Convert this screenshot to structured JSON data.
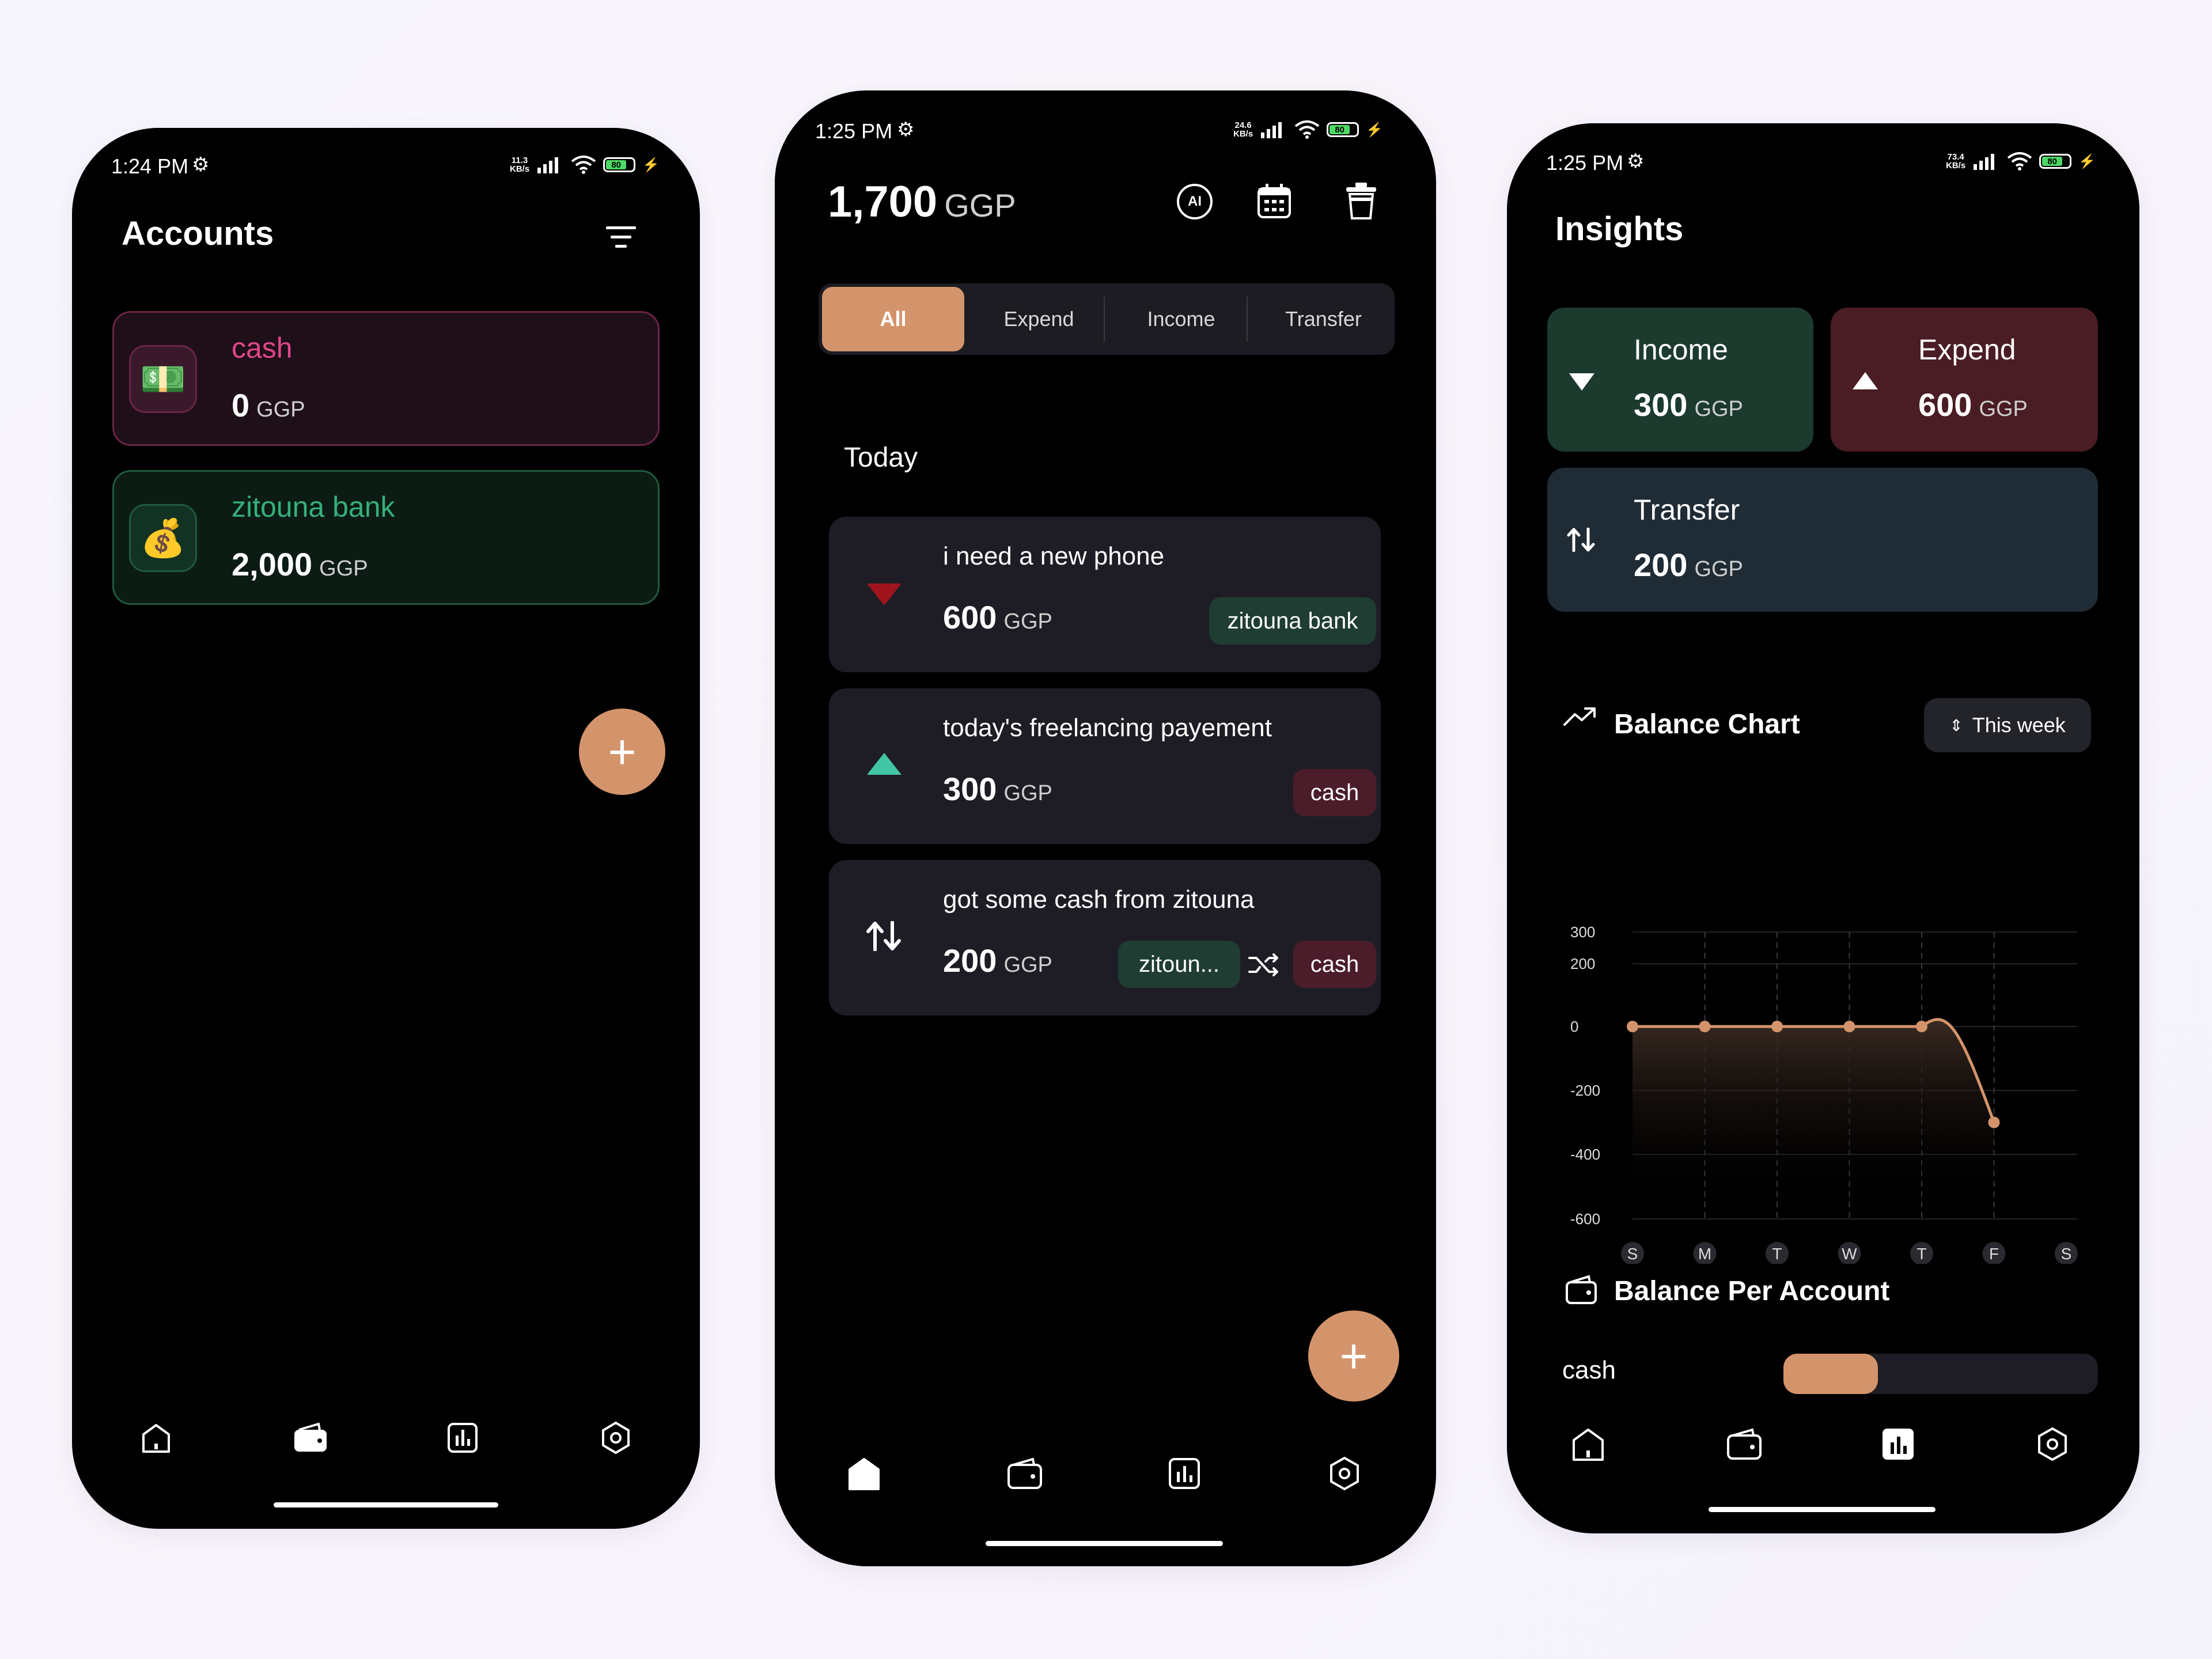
{
  "phone1": {
    "time": "1:24 PM",
    "kbs_value": "11.3",
    "kbs_unit": "KB/s",
    "battery": "80",
    "title": "Accounts",
    "accounts": [
      {
        "name": "cash",
        "amount": "0",
        "unit": "GGP",
        "icon": "banknote-icon",
        "color": "#e0478a"
      },
      {
        "name": "zitouna bank",
        "amount": "2,000",
        "unit": "GGP",
        "icon": "money-bag-icon",
        "color": "#35b07a"
      }
    ],
    "fab": "+"
  },
  "phone2": {
    "time": "1:25 PM",
    "kbs_value": "24.6",
    "kbs_unit": "KB/s",
    "battery": "80",
    "balance": "1,700",
    "balance_unit": "GGP",
    "ai_label": "AI",
    "tabs": [
      "All",
      "Expend",
      "Income",
      "Transfer"
    ],
    "section": "Today",
    "transactions": [
      {
        "desc": "i need a new phone",
        "amount": "600",
        "unit": "GGP",
        "type": "expend",
        "account": "zitouna bank"
      },
      {
        "desc": "today's freelancing payement",
        "amount": "300",
        "unit": "GGP",
        "type": "income",
        "account": "cash"
      },
      {
        "desc": "got some cash from zitouna",
        "amount": "200",
        "unit": "GGP",
        "type": "transfer",
        "from": "zitoun...",
        "to": "cash"
      }
    ],
    "fab": "+"
  },
  "phone3": {
    "time": "1:25 PM",
    "kbs_value": "73.4",
    "kbs_unit": "KB/s",
    "battery": "80",
    "title": "Insights",
    "income": {
      "label": "Income",
      "amount": "300",
      "unit": "GGP"
    },
    "expend": {
      "label": "Expend",
      "amount": "600",
      "unit": "GGP"
    },
    "transfer": {
      "label": "Transfer",
      "amount": "200",
      "unit": "GGP"
    },
    "chart_title": "Balance Chart",
    "period": "This week",
    "per_account_title": "Balance Per Account",
    "per_account": [
      {
        "name": "cash",
        "share": 0.3
      }
    ]
  },
  "colors": {
    "accent": "#d4946b",
    "income_bg": "#1c3a2e",
    "expend_bg": "#4a1c24",
    "transfer_bg": "#1f2c36"
  },
  "chart_data": {
    "type": "line",
    "title": "Balance Chart",
    "categories": [
      "S",
      "M",
      "T",
      "W",
      "T",
      "F",
      "S"
    ],
    "series": [
      {
        "values": [
          0,
          0,
          0,
          0,
          0,
          -300,
          null
        ]
      }
    ],
    "y_ticks": [
      "300",
      "200",
      "0",
      "-200",
      "-400",
      "-600"
    ],
    "ylim": [
      -600,
      300
    ],
    "grid": true,
    "xlabel": "",
    "ylabel": ""
  }
}
